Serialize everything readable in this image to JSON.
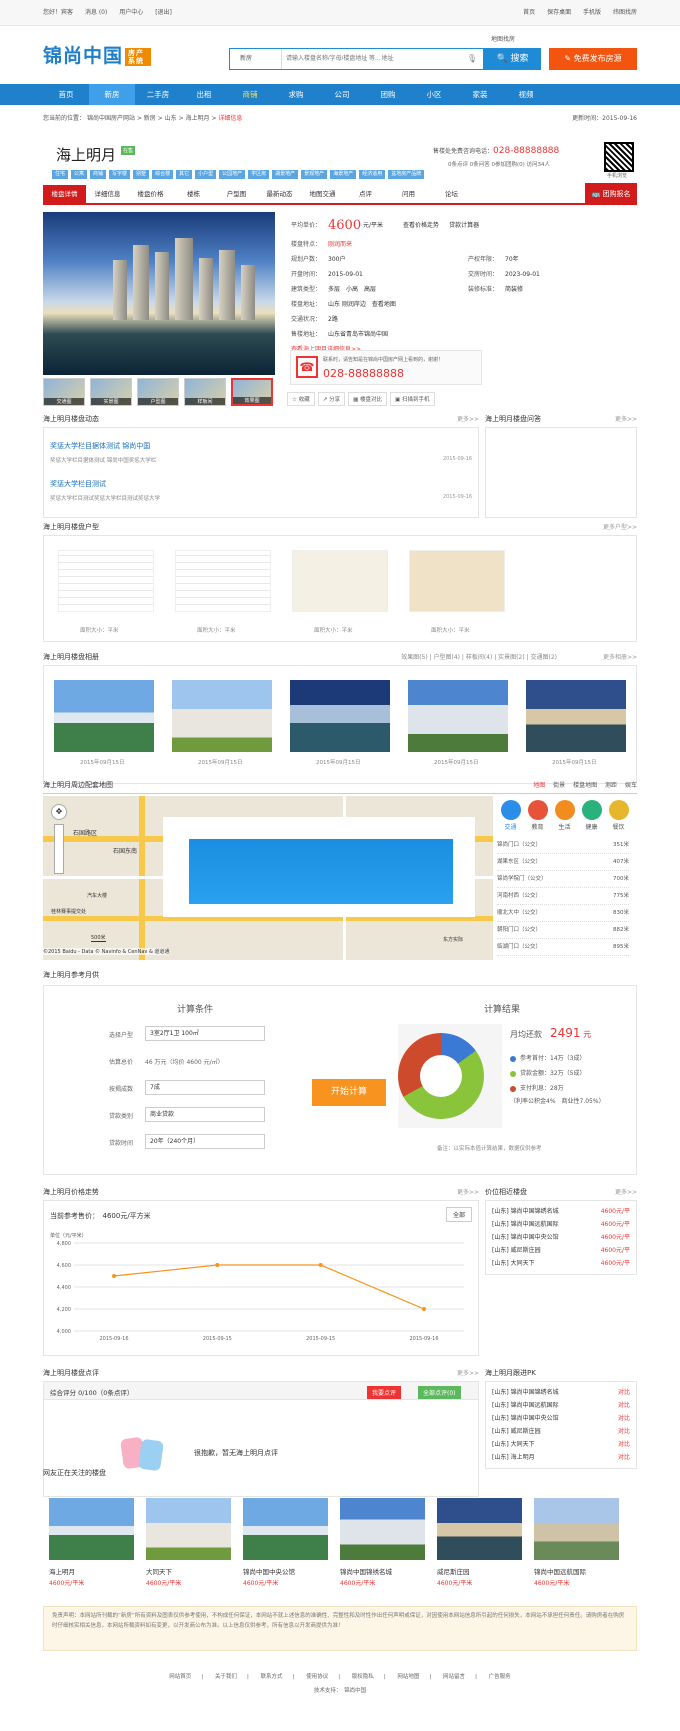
{
  "topbar": {
    "welcome": "您好！宾客",
    "msg": "消息 (0)",
    "center": "用户中心",
    "logout": "[退出]",
    "home": "首页",
    "save": "保存桌面",
    "mobile": "手机版",
    "map": "纬图找房"
  },
  "header": {
    "logo": "锦尚中国",
    "logo_sub": "房产系统",
    "map_search": "地图找房",
    "select": "新房",
    "placeholder": "请输入楼盘名称/字母/楼盘地址 等... 地址",
    "search": "搜索",
    "publish": "免费发布房源"
  },
  "nav": [
    "首页",
    "新房",
    "二手房",
    "出租",
    "商铺",
    "求购",
    "公司",
    "团购",
    "小区",
    "家装",
    "视频"
  ],
  "crumb": {
    "path": "您当前的位置：",
    "a": "锦尚中国房产网站",
    "b": "新房",
    "c": "山东",
    "d": "海上明月",
    "e": "详细信息",
    "update": "更新时间：",
    "update_val": "2015-09-16"
  },
  "project": {
    "title": "海上明月",
    "tag": "在售",
    "tags": [
      "住宅",
      "公寓",
      "商铺",
      "写字楼",
      "别墅",
      "综合楼",
      "其它",
      "小户型",
      "公园地产",
      "学区房",
      "湖景地产",
      "景观地产",
      "海景地产",
      "经济适用",
      "盆地房产品牌"
    ],
    "hotline_label": "售楼处免费咨询电话：",
    "hotline": "028-88888888",
    "stats": "0条点评  0条问答  0参加团购(0)  访问34人",
    "qr_label": "手机浏览"
  },
  "tabs": [
    "楼盘详情",
    "详细信息",
    "楼盘价格",
    "楼栋",
    "户型图",
    "最新动态",
    "地图交通",
    "点评",
    "问用",
    "论坛"
  ],
  "tab_group": "团购报名",
  "thumbs": [
    "交通图",
    "实景图",
    "户型图",
    "样板间",
    "效果图"
  ],
  "info": {
    "price_k": "平均单价：",
    "price": "4600",
    "price_unit": "元/平米",
    "price_link": "查看价格走势",
    "calc_link": "贷款计算器",
    "feature_k": "楼盘特点：",
    "feature": "刚润而来",
    "plan_k": "规划户数：",
    "plan": "300户",
    "years_k": "产权年限：",
    "years": "70年",
    "open_k": "开盘时间：",
    "open": "2015-09-01",
    "deliver_k": "交房时间：",
    "deliver": "2023-09-01",
    "type_k": "建筑类型：",
    "type": "多层　小高　高层",
    "deco_k": "装修标准：",
    "deco": "简装修",
    "addr_k": "楼盘地址：",
    "addr": "山东 刚润岸边",
    "map_link": "查看地图",
    "traffic_k": "交通状况：",
    "traffic": "2路",
    "sale_k": "售楼地址：",
    "sale": "山东省青岛市锦尚中国",
    "detail_link": "查看海上明月详细信息>>",
    "call_tip": "联系时，请告知是在锦尚中国房产网上看到的，谢谢！",
    "call_phone": "028-88888888"
  },
  "actions": [
    "收藏",
    "分享",
    "楼盘对比",
    "扫描到手机"
  ],
  "news": {
    "title": "海上明月楼盘动态",
    "more": "更多>>",
    "items": [
      {
        "t": "奖惩大学栏目据体测试 锦尚中国",
        "d": "奖惩大学栏目据体测试 锦尚中国奖惩大学栏",
        "dt": "2015-09-16"
      },
      {
        "t": "奖惩大学栏目测试",
        "d": "奖惩大学栏目测试奖惩大学栏目测试奖惩大学",
        "dt": "2015-09-16"
      }
    ]
  },
  "qa": {
    "title": "海上明月楼盘问答",
    "more": "更多>>"
  },
  "plans": {
    "title": "海上明月楼盘户型",
    "more": "更多户型>>",
    "items": [
      "面积大小：平米",
      "面积大小：平米",
      "面积大小：平米",
      "面积大小：平米"
    ]
  },
  "album": {
    "title": "海上明月楼盘相册",
    "links": "效果图(5) | 户型图(4) | 样板间(4) | 实景图(2) | 交通图(2)",
    "more": "更多相册>>",
    "items": [
      "2015年09月15日",
      "2015年09月15日",
      "2015年09月15日",
      "2015年09月15日",
      "2015年09月15日"
    ]
  },
  "mapsec": {
    "title": "海上明月周边配套地图",
    "tabs": [
      "地图",
      "街景",
      "楼盘地图",
      "测距",
      "娱车"
    ],
    "labels": [
      "石国路区",
      "石国东南",
      "汽车大楼",
      "桂林赛事提交处",
      "500米",
      "©2015 Baidu - Data © Navinfo & CenNav & 道道通",
      "东方实际"
    ],
    "cats": [
      "交通",
      "教育",
      "生活",
      "健康",
      "餐饮"
    ],
    "pois": [
      [
        "锦尚门口（公交）",
        "351米"
      ],
      [
        "湖果东区（公交）",
        "407米"
      ],
      [
        "锦尚学院门（公交）",
        "700米"
      ],
      [
        "河南村西（公交）",
        "775米"
      ],
      [
        "顺北大中（公交）",
        "830米"
      ],
      [
        "朝阳门口（公交）",
        "882米"
      ],
      [
        "临湖门口（公交）",
        "895米"
      ]
    ]
  },
  "calcsec": {
    "title": "海上明月参考月供",
    "cond": "计算条件",
    "result": "计算结果",
    "l1": "选择户型",
    "v1": "3室2厅1卫 100㎡",
    "l2": "估算总价",
    "v2": "46 万元（均价 4600 元/㎡）",
    "l3": "按揭成数",
    "v3": "7成",
    "l4": "贷款类别",
    "v4": "商业贷款",
    "l5": "贷款时间",
    "v5": "20年（240个月）",
    "btn": "开始计算",
    "monthly_k": "月均还款",
    "monthly": "2491",
    "monthly_u": "元",
    "r1": "参考首付：14万（3成）",
    "r2": "贷款金额：32万（5成）",
    "r3": "支付利息：28万",
    "r4": "（利率公积金4%　商业性7.05%）",
    "note": "备注：以实际本值计算结果，数据仅供参考"
  },
  "trendsec": {
    "title": "海上明月价格走势",
    "more": "更多>>",
    "cur_k": "当前参考售价：",
    "cur": "4600元/平方米",
    "all": "全部",
    "unit": "单位（元/平米）"
  },
  "chart_data": {
    "type": "line",
    "x": [
      "2015-09-16",
      "2015-09-15",
      "2015-09-15",
      "2015-09-16"
    ],
    "values": [
      4500,
      4600,
      4600,
      4200
    ],
    "ylim": [
      4000,
      4800
    ],
    "yticks": [
      "4,800",
      "4,600",
      "4,400",
      "4,200",
      "4,000"
    ],
    "color": "#f7931e"
  },
  "similar": {
    "title": "价位相近楼盘",
    "more": "更多>>",
    "items": [
      [
        "[山东] 锦尚中国锦绣名城",
        "4600元/平"
      ],
      [
        "[山东] 锦尚中国远航国际",
        "4600元/平"
      ],
      [
        "[山东] 锦尚中国中央公馆",
        "4600元/平"
      ],
      [
        "[山东] 威尼斯庄园",
        "4600元/平"
      ],
      [
        "[山东] 大同天下",
        "4600元/平"
      ]
    ]
  },
  "review": {
    "title": "海上明月楼盘点评",
    "more": "更多>>",
    "score": "综合评分 0/100（0条点评）",
    "bad": "我要点评",
    "all": "全部点评(0)",
    "empty": "很抱歉，暂无海上明月点评"
  },
  "follow": {
    "title": "海上明月跟进PK",
    "items": [
      [
        "[山东] 锦尚中国锦绣名城",
        "对比"
      ],
      [
        "[山东] 锦尚中国远航国际",
        "对比"
      ],
      [
        "[山东] 锦尚中国中央公馆",
        "对比"
      ],
      [
        "[山东] 威尼斯庄园",
        "对比"
      ],
      [
        "[山东] 大同天下",
        "对比"
      ],
      [
        "[山东] 海上明月",
        "对比"
      ]
    ]
  },
  "watch": {
    "title": "网友正在关注的楼盘",
    "items": [
      [
        "海上明月",
        "4600元/平米"
      ],
      [
        "大同天下",
        "4600元/平米"
      ],
      [
        "锦尚中国中央公馆",
        "4600元/平米"
      ],
      [
        "锦尚中国锦绣名城",
        "4600元/平米"
      ],
      [
        "威尼斯庄园",
        "4600元/平米"
      ],
      [
        "锦尚中国远航国际",
        "4600元/平米"
      ]
    ]
  },
  "disclaimer": "免责声明：本网站所刊载的“新房”所有资料及图表仅供参考使用，不构成任何保证，本网站不就上述信息的准确性、完整性和及时性作出任何声明或保证，对因使用本网站信息所引起的任何损失，本网站不承担任何责任。请购房者在购房时仔细核实相关信息，本网站所载资料如有变更，以开发商公布为准。以上信息仅供参考，所有信息以开发商提供为准！",
  "footer": {
    "links": [
      "网站首页",
      "关于我们",
      "联系方式",
      "使用协议",
      "版权隐私",
      "网站地图",
      "网站留言",
      "广告服务"
    ],
    "support": "技术支持：　锦尚中国"
  }
}
